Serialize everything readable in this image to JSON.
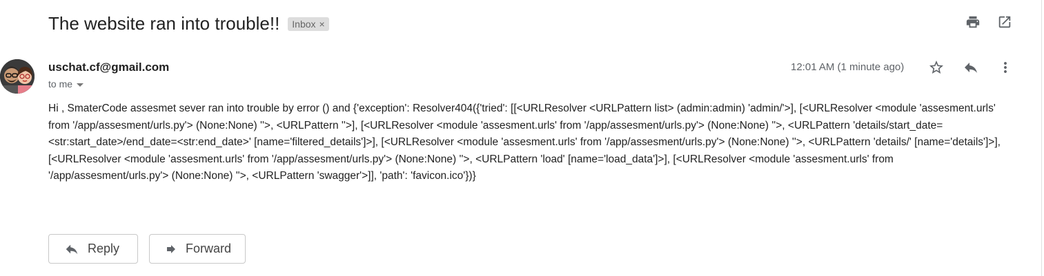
{
  "email": {
    "subject": "The website ran into trouble!!",
    "label": "Inbox",
    "label_close": "×",
    "sender": "uschat.cf@gmail.com",
    "recipient": "to me",
    "timestamp": "12:01 AM (1 minute ago)",
    "body": "Hi , SmaterCode assesmet sever ran into trouble by error () and {'exception': Resolver404({'tried': [[<URLResolver <URLPattern list> (admin:admin) 'admin/'>], [<URLResolver <module 'assesment.urls' from '/app/assesment/urls.py'> (None:None) ''>, <URLPattern ''>], [<URLResolver <module 'assesment.urls' from '/app/assesment/urls.py'> (None:None) ''>, <URLPattern 'details/start_date=<str:start_date>/end_date=<str:end_date>' [name='filtered_details']>], [<URLResolver <module 'assesment.urls' from '/app/assesment/urls.py'> (None:None) ''>, <URLPattern 'details/' [name='details']>], [<URLResolver <module 'assesment.urls' from '/app/assesment/urls.py'> (None:None) ''>, <URLPattern 'load' [name='load_data']>], [<URLResolver <module 'assesment.urls' from '/app/assesment/urls.py'> (None:None) ''>, <URLPattern 'swagger'>]], 'path': 'favicon.ico'})}"
  },
  "actions": {
    "reply_label": "Reply",
    "forward_label": "Forward"
  },
  "icons": {
    "print": "print-icon",
    "open_new_window": "open-in-new-window-icon",
    "star": "star-icon",
    "reply": "reply-icon",
    "more": "more-vertical-icon",
    "forward": "forward-icon",
    "caret": "chevron-down-icon"
  },
  "colors": {
    "icon": "#5f6368",
    "chip_bg": "#dddddd",
    "text": "#222222",
    "muted": "#5f6368"
  }
}
